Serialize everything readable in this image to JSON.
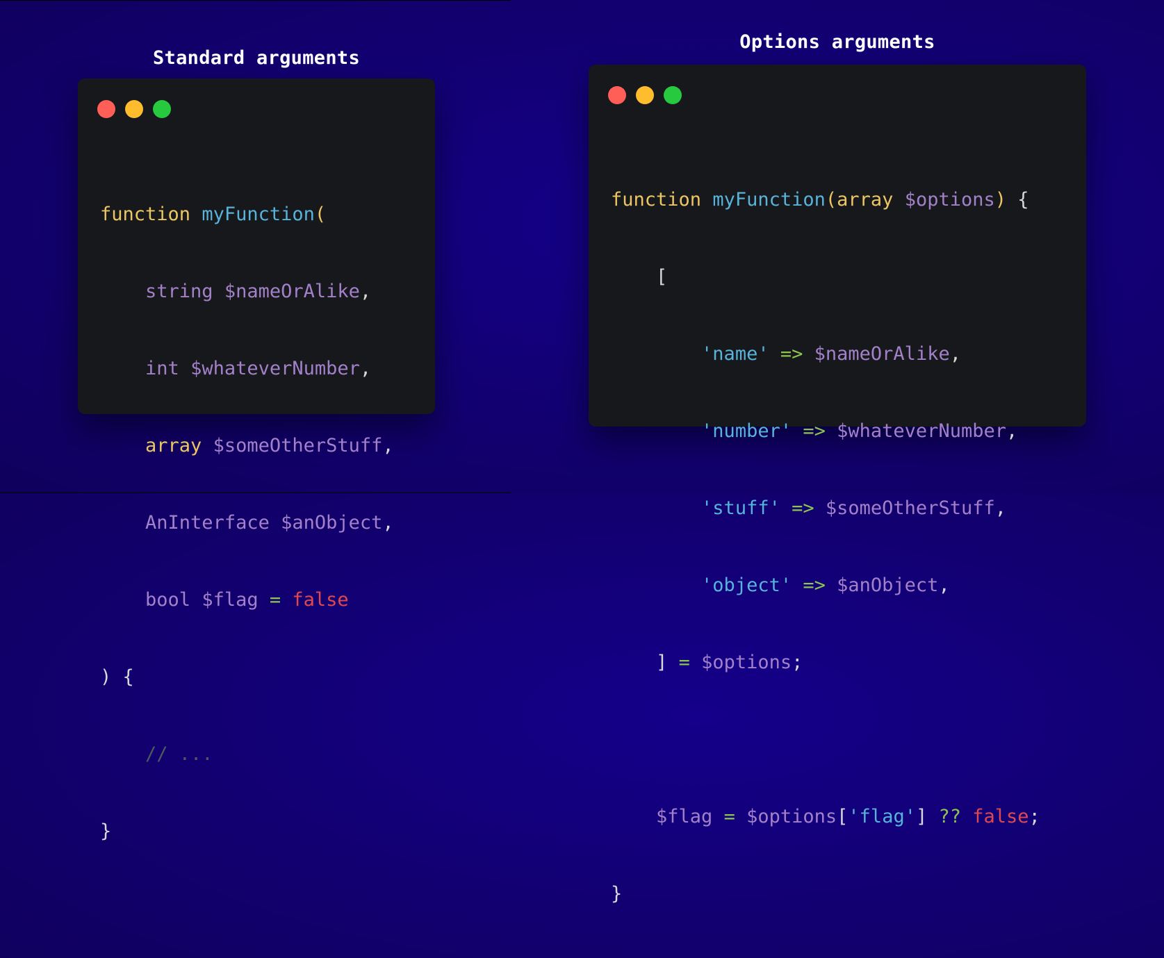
{
  "colors": {
    "background": "#12007a",
    "window": "#17181b",
    "dot_red": "#ff5f56",
    "dot_yellow": "#ffbd2e",
    "dot_green": "#27c93f"
  },
  "left_panel": {
    "title": "Standard arguments",
    "code": {
      "l1_function": "function ",
      "l1_name": "myFunction",
      "l1_paren": "(",
      "l2_type": "string",
      "l2_var": "$nameOrAlike",
      "l2_comma": ",",
      "l3_type": "int",
      "l3_var": "$whateverNumber",
      "l3_comma": ",",
      "l4_type": "array",
      "l4_var": "$someOtherStuff",
      "l4_comma": ",",
      "l5_type": "AnInterface",
      "l5_var": "$anObject",
      "l5_comma": ",",
      "l6_type": "bool",
      "l6_var": "$flag",
      "l6_eq": "=",
      "l6_val": "false",
      "l7_close": ") {",
      "l8_comment": "// ...",
      "l9_brace": "}"
    }
  },
  "right_panel": {
    "title": "Options arguments",
    "code": {
      "l1_function": "function ",
      "l1_name": "myFunction",
      "l1_open": "(",
      "l1_type": "array",
      "l1_var": "$options",
      "l1_close": ")",
      "l1_brace": " {",
      "l2_bracket": "[",
      "l3_key": "'name'",
      "l3_arrow": "=>",
      "l3_var": "$nameOrAlike",
      "l3_comma": ",",
      "l4_key": "'number'",
      "l4_arrow": "=>",
      "l4_var": "$whateverNumber",
      "l4_comma": ",",
      "l5_key": "'stuff'",
      "l5_arrow": "=>",
      "l5_var": "$someOtherStuff",
      "l5_comma": ",",
      "l6_key": "'object'",
      "l6_arrow": "=>",
      "l6_var": "$anObject",
      "l6_comma": ",",
      "l7_bracket": "]",
      "l7_eq": "=",
      "l7_var": "$options",
      "l7_semi": ";",
      "l9_var": "$flag",
      "l9_eq": "=",
      "l9_opts": "$options",
      "l9_lb": "[",
      "l9_key": "'flag'",
      "l9_rb": "]",
      "l9_coalesce": "??",
      "l9_val": "false",
      "l9_semi": ";",
      "l10_brace": "}"
    }
  }
}
